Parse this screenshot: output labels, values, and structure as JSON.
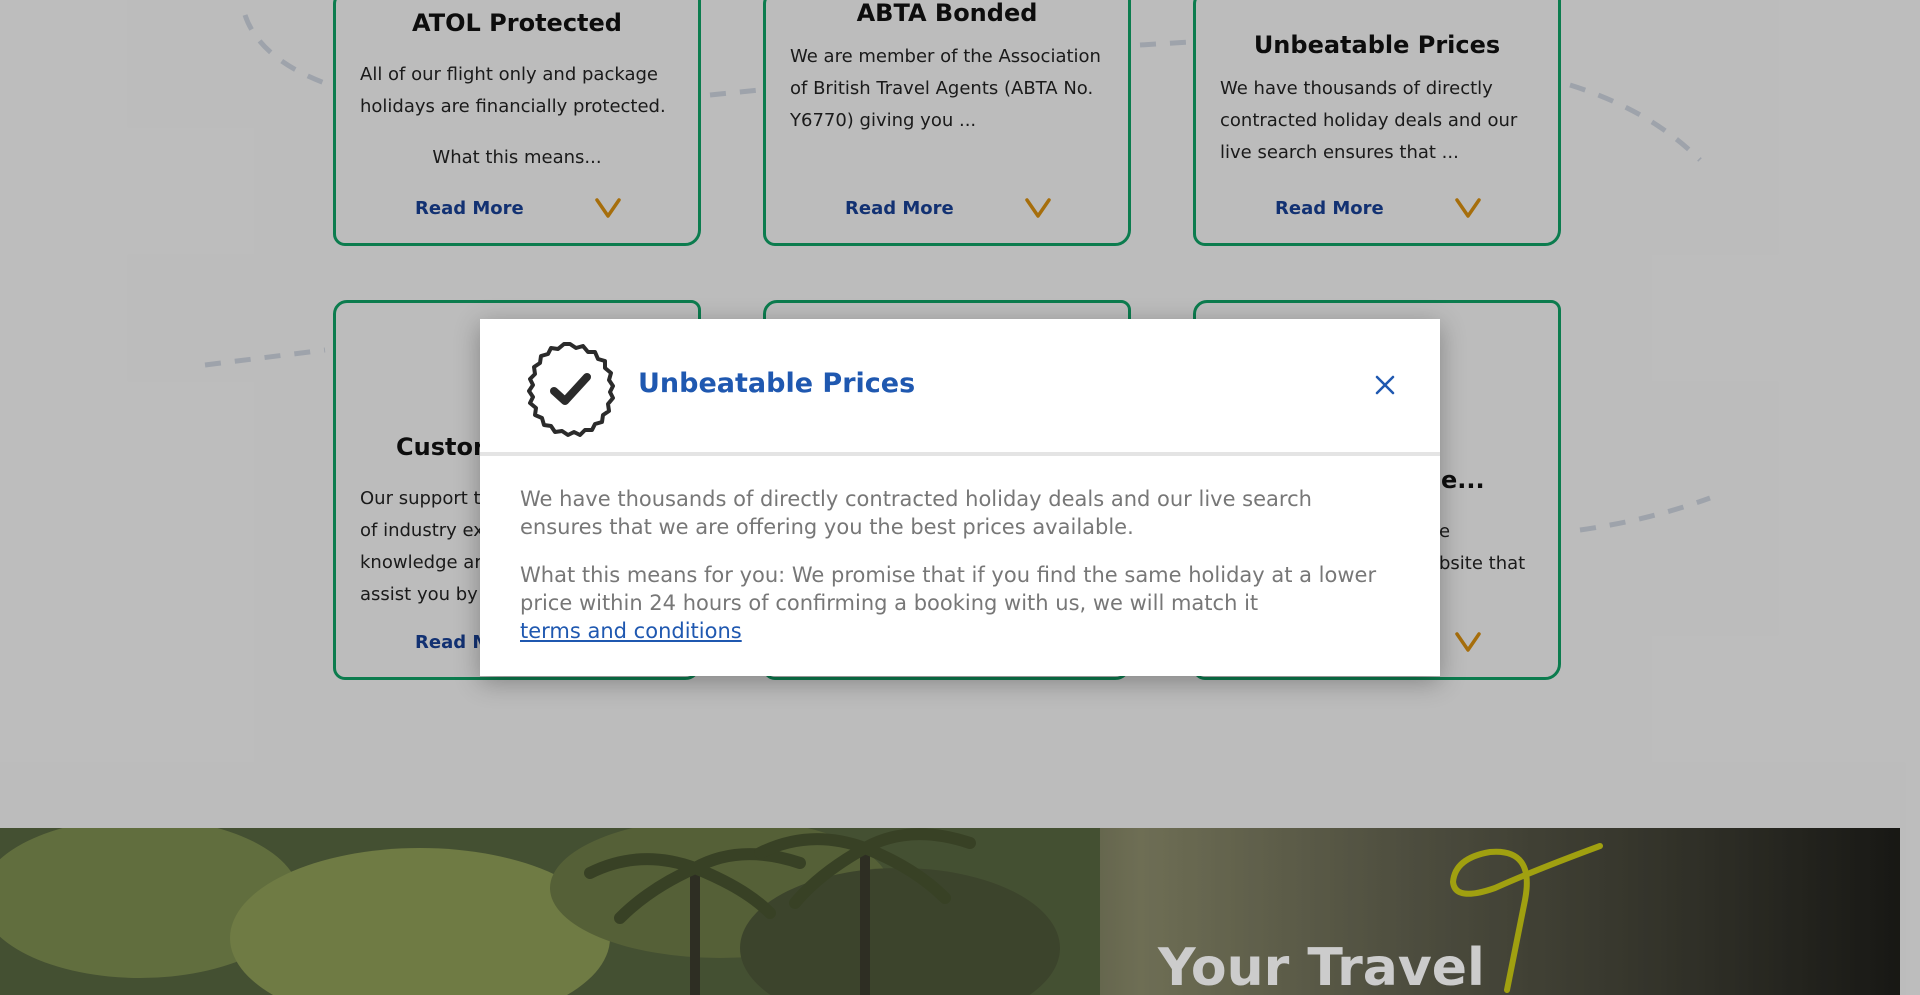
{
  "cards": [
    {
      "title": "ATOL Protected",
      "body": "All of our flight only and package holidays are financially protected.",
      "extra": "What this means...",
      "read_more": "Read More"
    },
    {
      "title": "ABTA Bonded",
      "body": "We are member of the Association of British Travel Agents (ABTA No. Y6770) giving you ...",
      "read_more": "Read More"
    },
    {
      "title": "Unbeatable Prices",
      "body": "We have thousands of directly contracted holiday deals and our live search ensures that ...",
      "read_more": "Read More"
    },
    {
      "title": "Custor",
      "body": "Our support t\nof industry ex\nknowledge ar\nassist you by",
      "read_more": "Read M"
    },
    {
      "title": "",
      "body": "",
      "read_more": ""
    },
    {
      "title": "e...",
      "body": "e\nbsite that",
      "read_more": ""
    }
  ],
  "modal": {
    "title": "Unbeatable Prices",
    "icon": "checkmark-badge-icon",
    "close_icon": "close-icon",
    "paragraph1": "We have thousands of directly contracted holiday deals and our live search ensures that we are offering you the best prices available.",
    "paragraph2": "What this means for you: We promise that if you find the same holiday at a lower price within 24 hours of confirming a booking with us, we will match it",
    "link_text": "terms and conditions",
    "colors": {
      "title": "#1f58b0",
      "link": "#1f58b0",
      "body_text": "#777777"
    }
  },
  "promo": {
    "title": "Your Travel"
  },
  "colors": {
    "card_border": "#0f9b62",
    "read_more": "#173e8f",
    "chevron": "#d08a10",
    "page_background": "#ececec",
    "promo_scribble": "#c8c814"
  }
}
